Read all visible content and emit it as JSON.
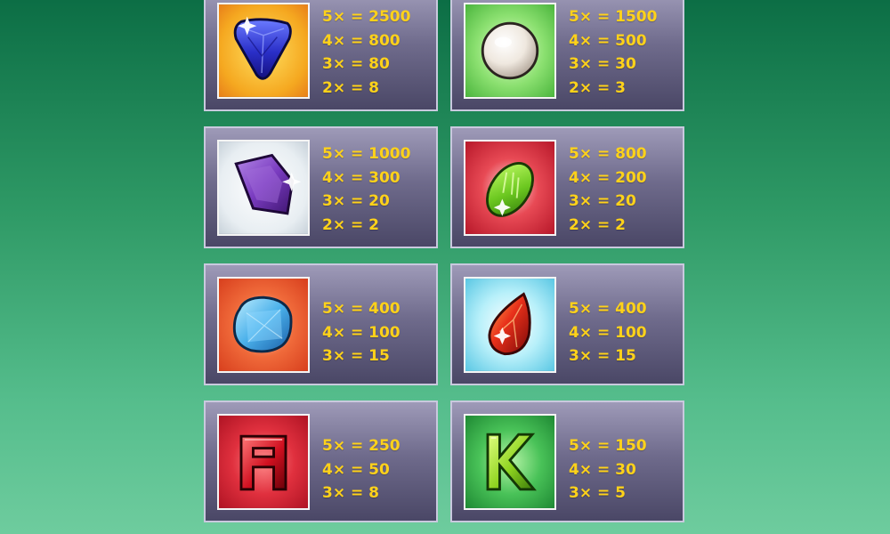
{
  "paytable": [
    {
      "symbol": "sapphire-gem",
      "icon": "blue-triangle-sapphire",
      "bg_color": "#f5a820",
      "pays": [
        "5× = 2500",
        "4× = 800",
        "3× = 80",
        "2× = 8"
      ]
    },
    {
      "symbol": "pearl",
      "icon": "white-pearl",
      "bg_color": "#6fcf55",
      "pays": [
        "5× = 1500",
        "4× = 500",
        "3× = 30",
        "2× = 3"
      ]
    },
    {
      "symbol": "amethyst-gem",
      "icon": "purple-amethyst",
      "bg_color": "#e8eef2",
      "pays": [
        "5× = 1000",
        "4× = 300",
        "3× = 20",
        "2× = 2"
      ]
    },
    {
      "symbol": "peridot-gem",
      "icon": "green-oval-peridot",
      "bg_color": "#d8283a",
      "pays": [
        "5× = 800",
        "4× = 200",
        "3× = 20",
        "2× = 2"
      ]
    },
    {
      "symbol": "aquamarine-gem",
      "icon": "blue-cushion-aquamarine",
      "bg_color": "#f06a3a",
      "pays": [
        "5× = 400",
        "4× = 100",
        "3× = 15"
      ]
    },
    {
      "symbol": "ruby-gem",
      "icon": "red-pear-ruby",
      "bg_color": "#7fd8ea",
      "pays": [
        "5× = 400",
        "4× = 100",
        "3× = 15"
      ]
    },
    {
      "symbol": "letter-a",
      "icon": "red-letter-a",
      "bg_color": "#d8283a",
      "letter": "A",
      "pays": [
        "5× = 250",
        "4× = 50",
        "3× = 8"
      ]
    },
    {
      "symbol": "letter-k",
      "icon": "green-letter-k",
      "bg_color": "#49c258",
      "letter": "K",
      "pays": [
        "5× = 150",
        "4× = 30",
        "3× = 5"
      ]
    }
  ]
}
